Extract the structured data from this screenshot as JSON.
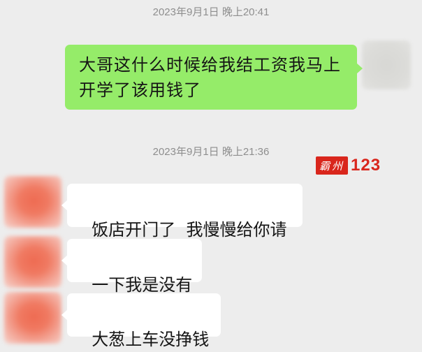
{
  "timestamps": [
    "2023年9月1日 晚上20:41",
    "2023年9月1日 晚上21:36"
  ],
  "messages": [
    {
      "side": "sent",
      "text": "大哥这什么时候给我结工资我马上开学了该用钱了"
    },
    {
      "side": "received",
      "text": "饭店开门了  我慢慢给你请"
    },
    {
      "side": "received",
      "text": "一下我是没有"
    },
    {
      "side": "received",
      "text": "大葱上车没挣钱"
    }
  ],
  "watermark": {
    "seal_text": "霸州",
    "number": "123",
    "color": "#d9261c"
  },
  "colors": {
    "background": "#ededed",
    "sent_bubble": "#95ec69",
    "received_bubble": "#ffffff",
    "timestamp_text": "#8e8e8e"
  },
  "avatars": {
    "self": "blurred-avatar",
    "other": "blurred-avatar"
  }
}
